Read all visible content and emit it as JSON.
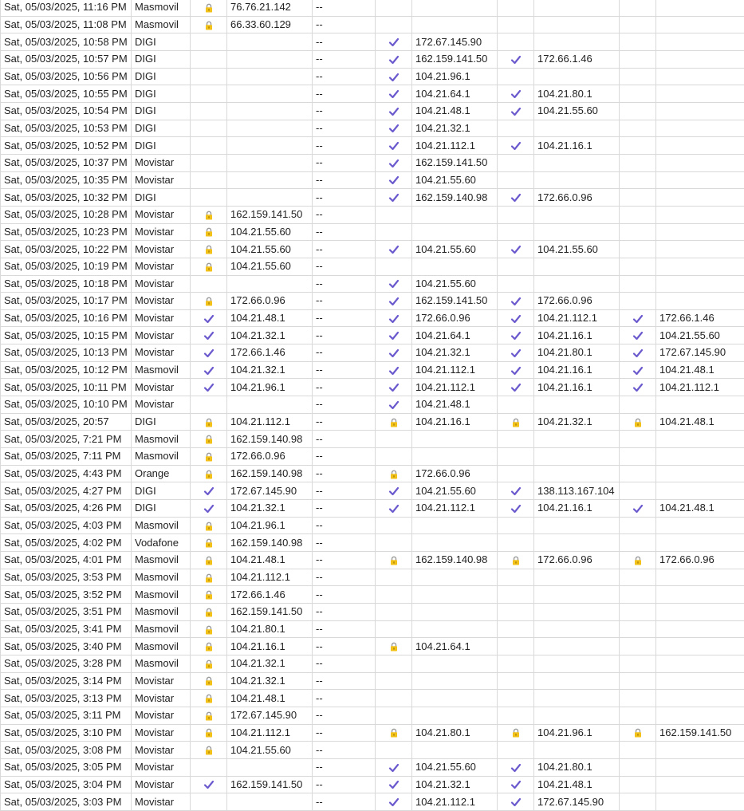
{
  "colors": {
    "check": "#6a5acd",
    "lock_body": "#f2c21b",
    "lock_shackle": "#9a9a9a",
    "grid": "#d9d9d9"
  },
  "icons": {
    "ok": "check-icon",
    "lock": "lock-icon"
  },
  "rows": [
    {
      "date": "Sat, 05/03/2025, 11:16 PM",
      "isp": "Masmovil",
      "s1": "lock",
      "ip1": "76.76.21.142",
      "dash": "--",
      "s2": "",
      "ip2": "",
      "s3": "",
      "ip3": "",
      "s4": "",
      "ip4": ""
    },
    {
      "date": "Sat, 05/03/2025, 11:08 PM",
      "isp": "Masmovil",
      "s1": "lock",
      "ip1": "66.33.60.129",
      "dash": "--",
      "s2": "",
      "ip2": "",
      "s3": "",
      "ip3": "",
      "s4": "",
      "ip4": ""
    },
    {
      "date": "Sat, 05/03/2025, 10:58 PM",
      "isp": "DIGI",
      "s1": "",
      "ip1": "",
      "dash": "--",
      "s2": "ok",
      "ip2": "172.67.145.90",
      "s3": "",
      "ip3": "",
      "s4": "",
      "ip4": ""
    },
    {
      "date": "Sat, 05/03/2025, 10:57 PM",
      "isp": "DIGI",
      "s1": "",
      "ip1": "",
      "dash": "--",
      "s2": "ok",
      "ip2": "162.159.141.50",
      "s3": "ok",
      "ip3": "172.66.1.46",
      "s4": "",
      "ip4": ""
    },
    {
      "date": "Sat, 05/03/2025, 10:56 PM",
      "isp": "DIGI",
      "s1": "",
      "ip1": "",
      "dash": "--",
      "s2": "ok",
      "ip2": "104.21.96.1",
      "s3": "",
      "ip3": "",
      "s4": "",
      "ip4": ""
    },
    {
      "date": "Sat, 05/03/2025, 10:55 PM",
      "isp": "DIGI",
      "s1": "",
      "ip1": "",
      "dash": "--",
      "s2": "ok",
      "ip2": "104.21.64.1",
      "s3": "ok",
      "ip3": "104.21.80.1",
      "s4": "",
      "ip4": ""
    },
    {
      "date": "Sat, 05/03/2025, 10:54 PM",
      "isp": "DIGI",
      "s1": "",
      "ip1": "",
      "dash": "--",
      "s2": "ok",
      "ip2": "104.21.48.1",
      "s3": "ok",
      "ip3": "104.21.55.60",
      "s4": "",
      "ip4": ""
    },
    {
      "date": "Sat, 05/03/2025, 10:53 PM",
      "isp": "DIGI",
      "s1": "",
      "ip1": "",
      "dash": "--",
      "s2": "ok",
      "ip2": "104.21.32.1",
      "s3": "",
      "ip3": "",
      "s4": "",
      "ip4": ""
    },
    {
      "date": "Sat, 05/03/2025, 10:52 PM",
      "isp": "DIGI",
      "s1": "",
      "ip1": "",
      "dash": "--",
      "s2": "ok",
      "ip2": "104.21.112.1",
      "s3": "ok",
      "ip3": "104.21.16.1",
      "s4": "",
      "ip4": ""
    },
    {
      "date": "Sat, 05/03/2025, 10:37 PM",
      "isp": "Movistar",
      "s1": "",
      "ip1": "",
      "dash": "--",
      "s2": "ok",
      "ip2": "162.159.141.50",
      "s3": "",
      "ip3": "",
      "s4": "",
      "ip4": ""
    },
    {
      "date": "Sat, 05/03/2025, 10:35 PM",
      "isp": "Movistar",
      "s1": "",
      "ip1": "",
      "dash": "--",
      "s2": "ok",
      "ip2": "104.21.55.60",
      "s3": "",
      "ip3": "",
      "s4": "",
      "ip4": ""
    },
    {
      "date": "Sat, 05/03/2025, 10:32 PM",
      "isp": "DIGI",
      "s1": "",
      "ip1": "",
      "dash": "--",
      "s2": "ok",
      "ip2": "162.159.140.98",
      "s3": "ok",
      "ip3": "172.66.0.96",
      "s4": "",
      "ip4": ""
    },
    {
      "date": "Sat, 05/03/2025, 10:28 PM",
      "isp": "Movistar",
      "s1": "lock",
      "ip1": "162.159.141.50",
      "dash": "--",
      "s2": "",
      "ip2": "",
      "s3": "",
      "ip3": "",
      "s4": "",
      "ip4": ""
    },
    {
      "date": "Sat, 05/03/2025, 10:23 PM",
      "isp": "Movistar",
      "s1": "lock",
      "ip1": "104.21.55.60",
      "dash": "--",
      "s2": "",
      "ip2": "",
      "s3": "",
      "ip3": "",
      "s4": "",
      "ip4": ""
    },
    {
      "date": "Sat, 05/03/2025, 10:22 PM",
      "isp": "Movistar",
      "s1": "lock",
      "ip1": "104.21.55.60",
      "dash": "--",
      "s2": "ok",
      "ip2": "104.21.55.60",
      "s3": "ok",
      "ip3": "104.21.55.60",
      "s4": "",
      "ip4": ""
    },
    {
      "date": "Sat, 05/03/2025, 10:19 PM",
      "isp": "Movistar",
      "s1": "lock",
      "ip1": "104.21.55.60",
      "dash": "--",
      "s2": "",
      "ip2": "",
      "s3": "",
      "ip3": "",
      "s4": "",
      "ip4": ""
    },
    {
      "date": "Sat, 05/03/2025, 10:18 PM",
      "isp": "Movistar",
      "s1": "",
      "ip1": "",
      "dash": "--",
      "s2": "ok",
      "ip2": "104.21.55.60",
      "s3": "",
      "ip3": "",
      "s4": "",
      "ip4": ""
    },
    {
      "date": "Sat, 05/03/2025, 10:17 PM",
      "isp": "Movistar",
      "s1": "lock",
      "ip1": "172.66.0.96",
      "dash": "--",
      "s2": "ok",
      "ip2": "162.159.141.50",
      "s3": "ok",
      "ip3": "172.66.0.96",
      "s4": "",
      "ip4": ""
    },
    {
      "date": "Sat, 05/03/2025, 10:16 PM",
      "isp": "Movistar",
      "s1": "ok",
      "ip1": "104.21.48.1",
      "dash": "--",
      "s2": "ok",
      "ip2": "172.66.0.96",
      "s3": "ok",
      "ip3": "104.21.112.1",
      "s4": "ok",
      "ip4": "172.66.1.46"
    },
    {
      "date": "Sat, 05/03/2025, 10:15 PM",
      "isp": "Movistar",
      "s1": "ok",
      "ip1": "104.21.32.1",
      "dash": "--",
      "s2": "ok",
      "ip2": "104.21.64.1",
      "s3": "ok",
      "ip3": "104.21.16.1",
      "s4": "ok",
      "ip4": "104.21.55.60"
    },
    {
      "date": "Sat, 05/03/2025, 10:13 PM",
      "isp": "Movistar",
      "s1": "ok",
      "ip1": "172.66.1.46",
      "dash": "--",
      "s2": "ok",
      "ip2": "104.21.32.1",
      "s3": "ok",
      "ip3": "104.21.80.1",
      "s4": "ok",
      "ip4": "172.67.145.90"
    },
    {
      "date": "Sat, 05/03/2025, 10:12 PM",
      "isp": "Masmovil",
      "s1": "ok",
      "ip1": "104.21.32.1",
      "dash": "--",
      "s2": "ok",
      "ip2": "104.21.112.1",
      "s3": "ok",
      "ip3": "104.21.16.1",
      "s4": "ok",
      "ip4": "104.21.48.1"
    },
    {
      "date": "Sat, 05/03/2025, 10:11 PM",
      "isp": "Movistar",
      "s1": "ok",
      "ip1": "104.21.96.1",
      "dash": "--",
      "s2": "ok",
      "ip2": "104.21.112.1",
      "s3": "ok",
      "ip3": "104.21.16.1",
      "s4": "ok",
      "ip4": "104.21.112.1"
    },
    {
      "date": "Sat, 05/03/2025, 10:10 PM",
      "isp": "Movistar",
      "s1": "",
      "ip1": "",
      "dash": "--",
      "s2": "ok",
      "ip2": "104.21.48.1",
      "s3": "",
      "ip3": "",
      "s4": "",
      "ip4": ""
    },
    {
      "date": "Sat, 05/03/2025, 20:57",
      "isp": "DIGI",
      "s1": "lock",
      "ip1": "104.21.112.1",
      "dash": "--",
      "s2": "lock",
      "ip2": "104.21.16.1",
      "s3": "lock",
      "ip3": "104.21.32.1",
      "s4": "lock",
      "ip4": "104.21.48.1"
    },
    {
      "date": "Sat, 05/03/2025, 7:21 PM",
      "isp": "Masmovil",
      "s1": "lock",
      "ip1": "162.159.140.98",
      "dash": "--",
      "s2": "",
      "ip2": "",
      "s3": "",
      "ip3": "",
      "s4": "",
      "ip4": ""
    },
    {
      "date": "Sat, 05/03/2025, 7:11 PM",
      "isp": "Masmovil",
      "s1": "lock",
      "ip1": "172.66.0.96",
      "dash": "--",
      "s2": "",
      "ip2": "",
      "s3": "",
      "ip3": "",
      "s4": "",
      "ip4": ""
    },
    {
      "date": "Sat, 05/03/2025, 4:43 PM",
      "isp": "Orange",
      "s1": "lock",
      "ip1": "162.159.140.98",
      "dash": "--",
      "s2": "lock",
      "ip2": "172.66.0.96",
      "s3": "",
      "ip3": "",
      "s4": "",
      "ip4": ""
    },
    {
      "date": "Sat, 05/03/2025, 4:27 PM",
      "isp": "DIGI",
      "s1": "ok",
      "ip1": "172.67.145.90",
      "dash": "--",
      "s2": "ok",
      "ip2": "104.21.55.60",
      "s3": "ok",
      "ip3": "138.113.167.104",
      "s4": "",
      "ip4": ""
    },
    {
      "date": "Sat, 05/03/2025, 4:26 PM",
      "isp": "DIGI",
      "s1": "ok",
      "ip1": "104.21.32.1",
      "dash": "--",
      "s2": "ok",
      "ip2": "104.21.112.1",
      "s3": "ok",
      "ip3": "104.21.16.1",
      "s4": "ok",
      "ip4": "104.21.48.1"
    },
    {
      "date": "Sat, 05/03/2025, 4:03 PM",
      "isp": "Masmovil",
      "s1": "lock",
      "ip1": "104.21.96.1",
      "dash": "--",
      "s2": "",
      "ip2": "",
      "s3": "",
      "ip3": "",
      "s4": "",
      "ip4": ""
    },
    {
      "date": "Sat, 05/03/2025, 4:02 PM",
      "isp": "Vodafone",
      "s1": "lock",
      "ip1": "162.159.140.98",
      "dash": "--",
      "s2": "",
      "ip2": "",
      "s3": "",
      "ip3": "",
      "s4": "",
      "ip4": ""
    },
    {
      "date": "Sat, 05/03/2025, 4:01 PM",
      "isp": "Masmovil",
      "s1": "lock",
      "ip1": "104.21.48.1",
      "dash": "--",
      "s2": "lock",
      "ip2": "162.159.140.98",
      "s3": "lock",
      "ip3": "172.66.0.96",
      "s4": "lock",
      "ip4": "172.66.0.96"
    },
    {
      "date": "Sat, 05/03/2025, 3:53 PM",
      "isp": "Masmovil",
      "s1": "lock",
      "ip1": "104.21.112.1",
      "dash": "--",
      "s2": "",
      "ip2": "",
      "s3": "",
      "ip3": "",
      "s4": "",
      "ip4": ""
    },
    {
      "date": "Sat, 05/03/2025, 3:52 PM",
      "isp": "Masmovil",
      "s1": "lock",
      "ip1": "172.66.1.46",
      "dash": "--",
      "s2": "",
      "ip2": "",
      "s3": "",
      "ip3": "",
      "s4": "",
      "ip4": ""
    },
    {
      "date": "Sat, 05/03/2025, 3:51 PM",
      "isp": "Masmovil",
      "s1": "lock",
      "ip1": "162.159.141.50",
      "dash": "--",
      "s2": "",
      "ip2": "",
      "s3": "",
      "ip3": "",
      "s4": "",
      "ip4": ""
    },
    {
      "date": "Sat, 05/03/2025, 3:41 PM",
      "isp": "Masmovil",
      "s1": "lock",
      "ip1": "104.21.80.1",
      "dash": "--",
      "s2": "",
      "ip2": "",
      "s3": "",
      "ip3": "",
      "s4": "",
      "ip4": ""
    },
    {
      "date": "Sat, 05/03/2025, 3:40 PM",
      "isp": "Masmovil",
      "s1": "lock",
      "ip1": "104.21.16.1",
      "dash": "--",
      "s2": "lock",
      "ip2": "104.21.64.1",
      "s3": "",
      "ip3": "",
      "s4": "",
      "ip4": ""
    },
    {
      "date": "Sat, 05/03/2025, 3:28 PM",
      "isp": "Masmovil",
      "s1": "lock",
      "ip1": "104.21.32.1",
      "dash": "--",
      "s2": "",
      "ip2": "",
      "s3": "",
      "ip3": "",
      "s4": "",
      "ip4": ""
    },
    {
      "date": "Sat, 05/03/2025, 3:14 PM",
      "isp": "Movistar",
      "s1": "lock",
      "ip1": "104.21.32.1",
      "dash": "--",
      "s2": "",
      "ip2": "",
      "s3": "",
      "ip3": "",
      "s4": "",
      "ip4": ""
    },
    {
      "date": "Sat, 05/03/2025, 3:13 PM",
      "isp": "Movistar",
      "s1": "lock",
      "ip1": "104.21.48.1",
      "dash": "--",
      "s2": "",
      "ip2": "",
      "s3": "",
      "ip3": "",
      "s4": "",
      "ip4": ""
    },
    {
      "date": "Sat, 05/03/2025, 3:11 PM",
      "isp": "Movistar",
      "s1": "lock",
      "ip1": "172.67.145.90",
      "dash": "--",
      "s2": "",
      "ip2": "",
      "s3": "",
      "ip3": "",
      "s4": "",
      "ip4": ""
    },
    {
      "date": "Sat, 05/03/2025, 3:10 PM",
      "isp": "Movistar",
      "s1": "lock",
      "ip1": "104.21.112.1",
      "dash": "--",
      "s2": "lock",
      "ip2": "104.21.80.1",
      "s3": "lock",
      "ip3": "104.21.96.1",
      "s4": "lock",
      "ip4": "162.159.141.50"
    },
    {
      "date": "Sat, 05/03/2025, 3:08 PM",
      "isp": "Movistar",
      "s1": "lock",
      "ip1": "104.21.55.60",
      "dash": "--",
      "s2": "",
      "ip2": "",
      "s3": "",
      "ip3": "",
      "s4": "",
      "ip4": ""
    },
    {
      "date": "Sat, 05/03/2025, 3:05 PM",
      "isp": "Movistar",
      "s1": "",
      "ip1": "",
      "dash": "--",
      "s2": "ok",
      "ip2": "104.21.55.60",
      "s3": "ok",
      "ip3": "104.21.80.1",
      "s4": "",
      "ip4": ""
    },
    {
      "date": "Sat, 05/03/2025, 3:04 PM",
      "isp": "Movistar",
      "s1": "ok",
      "ip1": "162.159.141.50",
      "dash": "--",
      "s2": "ok",
      "ip2": "104.21.32.1",
      "s3": "ok",
      "ip3": "104.21.48.1",
      "s4": "",
      "ip4": ""
    },
    {
      "date": "Sat, 05/03/2025, 3:03 PM",
      "isp": "Movistar",
      "s1": "",
      "ip1": "",
      "dash": "--",
      "s2": "ok",
      "ip2": "104.21.112.1",
      "s3": "ok",
      "ip3": "172.67.145.90",
      "s4": "",
      "ip4": ""
    }
  ]
}
